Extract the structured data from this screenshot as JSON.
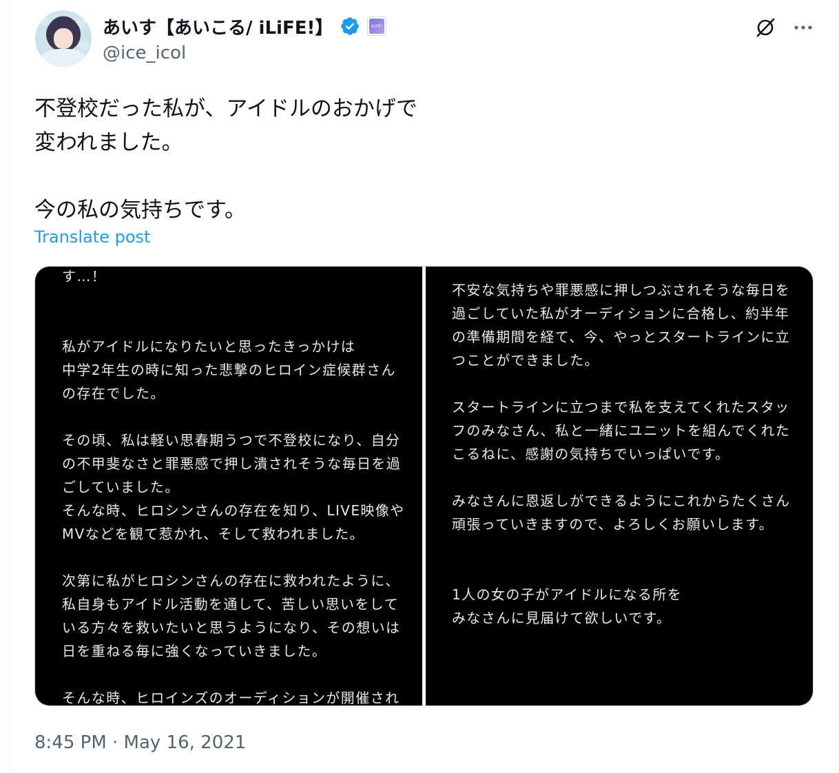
{
  "user": {
    "display_name": "あいす【あいこる/ iLiFE!】",
    "handle": "@ice_icol",
    "org_badge": "iLiFE!",
    "verified_color": "#1d9bf0"
  },
  "tweet": {
    "text": "不登校だった私が、アイドルのおかげで\n変われました。\n\n今の私の気持ちです。",
    "translate_label": "Translate post",
    "timestamp": "8:45 PM · May 16, 2021"
  },
  "media": {
    "left_lines": [
      "す…！",
      "",
      "",
      "私がアイドルになりたいと思ったきっかけは",
      "中学2年生の時に知った悲撃のヒロイン症候群さん",
      "の存在でした。",
      "",
      "その頃、私は軽い思春期うつで不登校になり、自分",
      "の不甲斐なさと罪悪感で押し潰されそうな毎日を過",
      "ごしていました。",
      "そんな時、ヒロシンさんの存在を知り、LIVE映像や",
      "MVなどを観て惹かれ、そして救われました。",
      "",
      "次第に私がヒロシンさんの存在に救われたように、",
      "私自身もアイドル活動を通して、苦しい思いをして",
      "いる方々を救いたいと思うようになり、その想いは",
      "日を重ねる毎に強くなっていきました。",
      "",
      "そんな時、ヒロインズのオーディションが開催され"
    ],
    "right_lines": [
      "",
      "不安な気持ちや罪悪感に押しつぶされそうな毎日を",
      "過ごしていた私がオーディションに合格し、約半年",
      "の準備期間を経て、今、やっとスタートラインに立",
      "つことができました。",
      "",
      "スタートラインに立つまで私を支えてくれたスタッ",
      "フのみなさん、私と一緒にユニットを組んでくれた",
      "こるねに、感謝の気持ちでいっぱいです。",
      "",
      "みなさんに恩返しができるようにこれからたくさん",
      "頑張っていきますので、よろしくお願いします。",
      "",
      "",
      "1人の女の子がアイドルになる所を",
      "みなさんに見届けて欲しいです。"
    ]
  },
  "icons": {
    "verified": "verified-badge-icon",
    "grok": "grok-icon",
    "more": "more-options-icon"
  }
}
